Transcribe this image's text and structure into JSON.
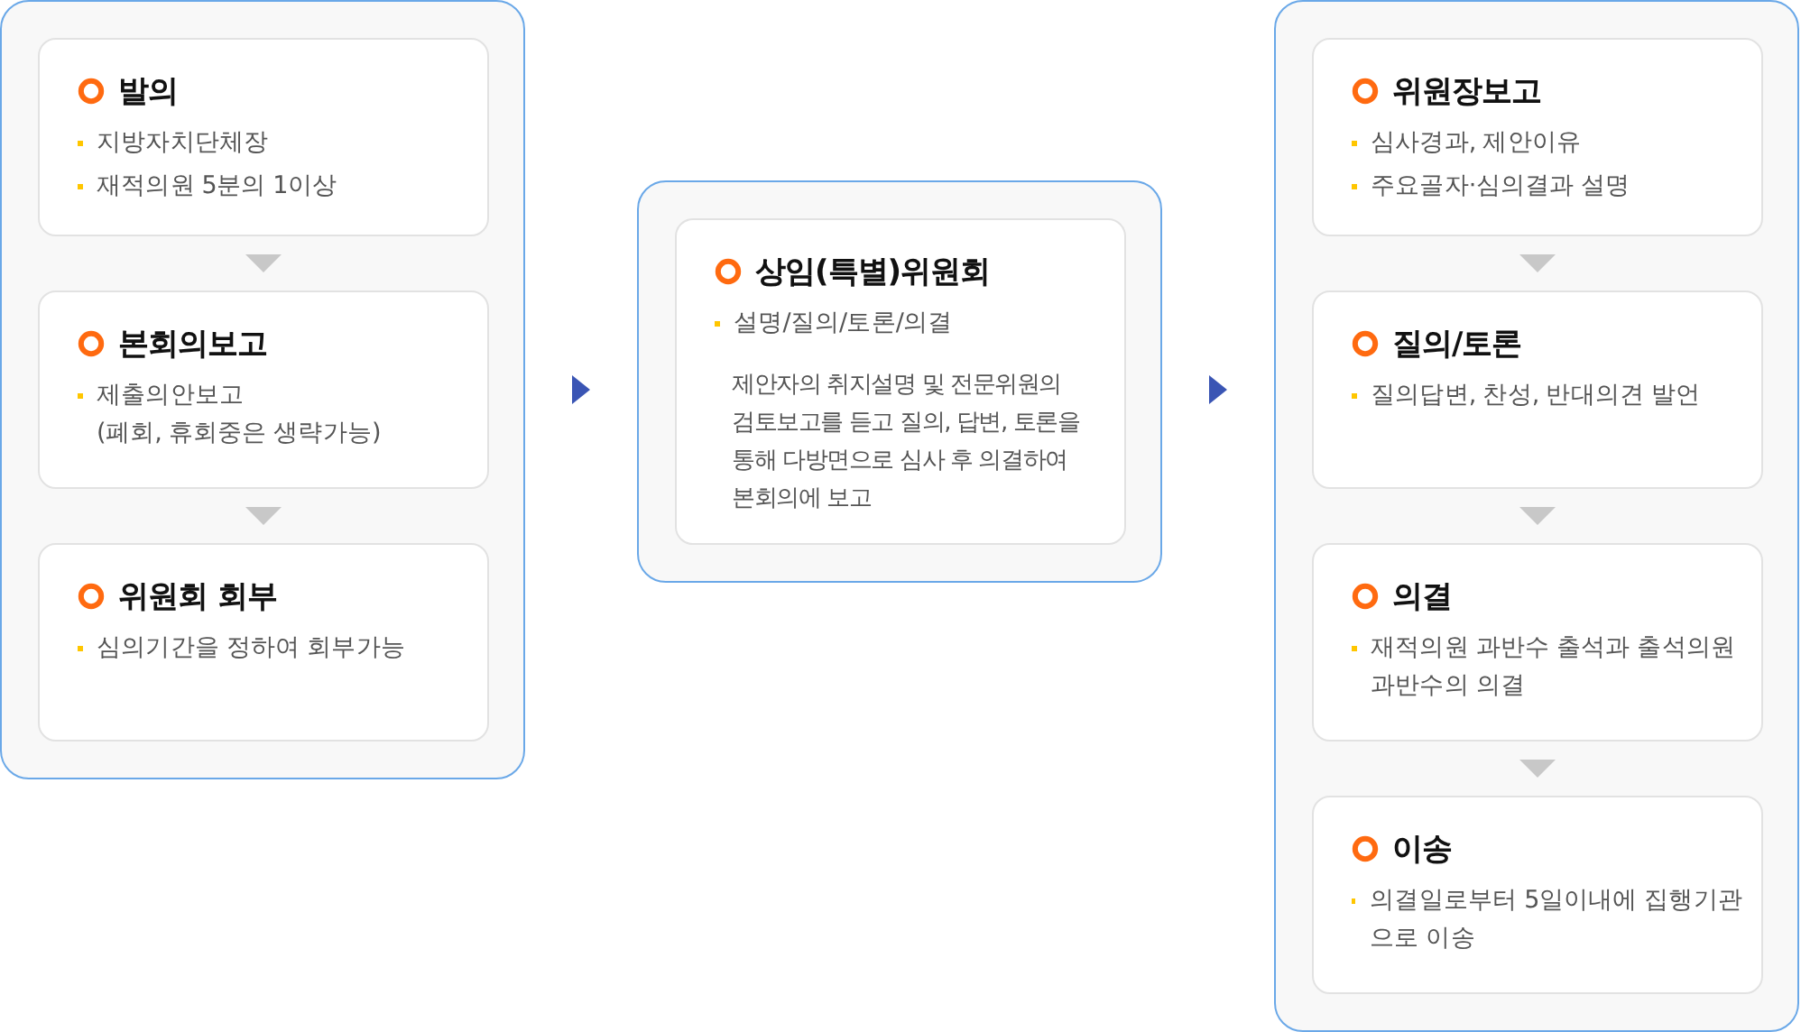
{
  "columns": [
    {
      "steps": [
        {
          "title": "발의",
          "bullets": [
            [
              "지방자치단체장"
            ],
            [
              "재적의원 5분의 1이상"
            ]
          ]
        },
        {
          "title": "본회의보고",
          "bullets": [
            [
              "제출의안보고",
              "(폐회, 휴회중은 생략가능)"
            ]
          ]
        },
        {
          "title": "위원회 회부",
          "bullets": [
            [
              "심의기간을 정하여 회부가능"
            ]
          ]
        }
      ]
    },
    {
      "steps": [
        {
          "title": "상임(특별)위원회",
          "bullets": [
            [
              "설명/질의/토론/의결"
            ]
          ],
          "paragraph": [
            "제안자의 취지설명 및 전문위원의",
            "검토보고를 듣고 질의, 답변, 토론을",
            "통해 다방면으로 심사 후 의결하여",
            "본회의에 보고"
          ]
        }
      ]
    },
    {
      "steps": [
        {
          "title": "위원장보고",
          "bullets": [
            [
              "심사경과, 제안이유"
            ],
            [
              "주요골자·심의결과 설명"
            ]
          ]
        },
        {
          "title": "질의/토론",
          "bullets": [
            [
              "질의답변, 찬성, 반대의견 발언"
            ]
          ]
        },
        {
          "title": "의결",
          "bullets": [
            [
              "재적의원 과반수 출석과 출석의원",
              "과반수의 의결"
            ]
          ]
        },
        {
          "title": "이송",
          "bullets": [
            [
              "의결일로부터 5일이내에 집행기관",
              "으로 이송"
            ]
          ]
        }
      ]
    }
  ]
}
